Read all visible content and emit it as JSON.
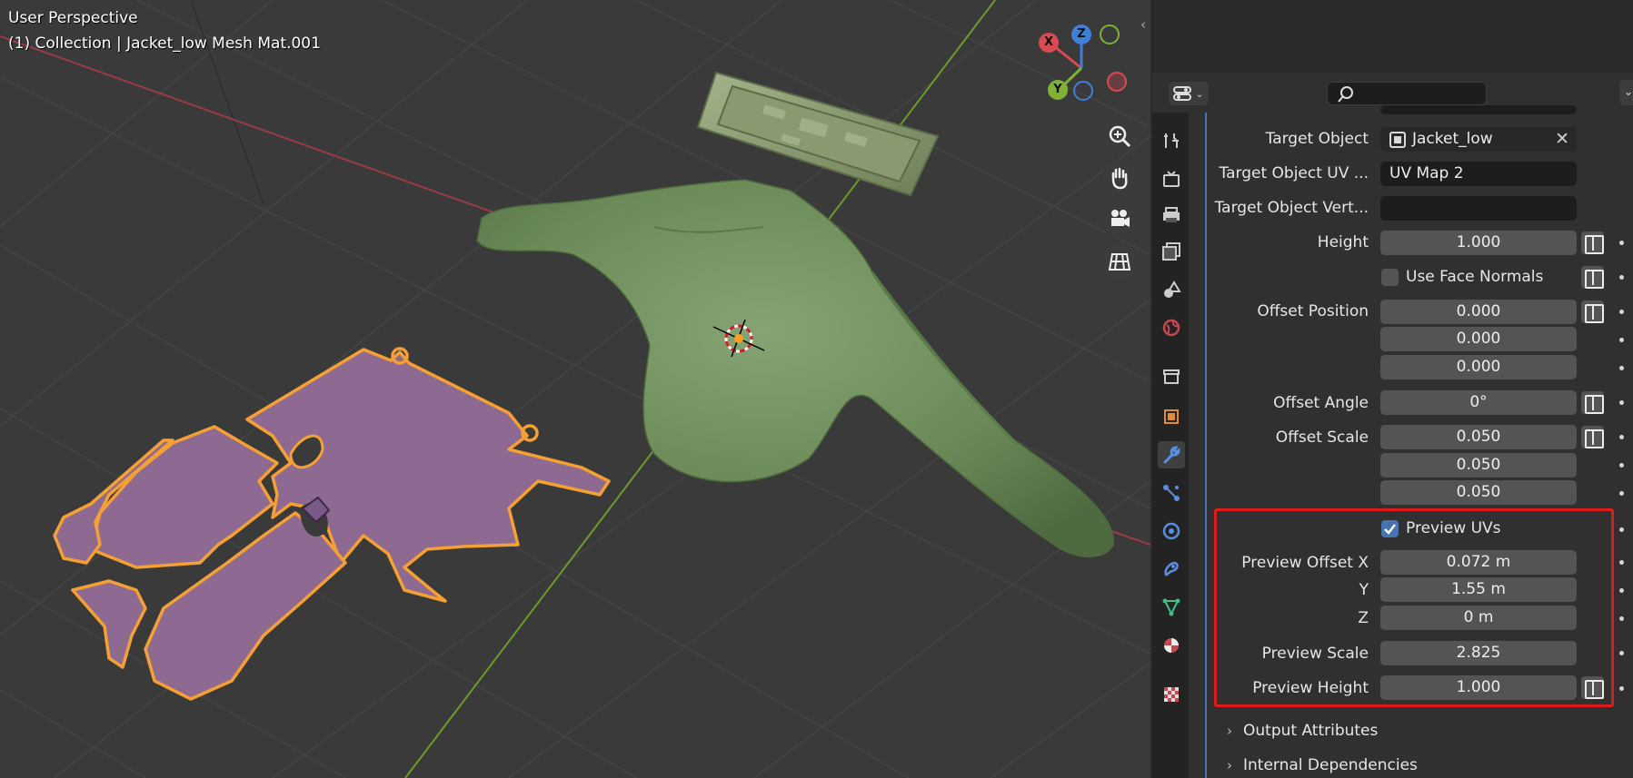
{
  "viewport": {
    "title": "User Perspective",
    "subtitle": "(1) Collection | Jacket_low Mesh Mat.001",
    "gizmo": {
      "x": "X",
      "y": "Y",
      "z": "Z"
    },
    "tools": [
      "zoom-icon",
      "pan-hand-icon",
      "camera-icon",
      "grid-ortho-icon"
    ]
  },
  "properties": {
    "fields": {
      "target_object_label": "Target Object",
      "target_object_value": "Jacket_low",
      "target_uv_label": "Target Object UV ...",
      "target_uv_value": "UV Map 2",
      "target_vert_label": "Target Object Vert...",
      "target_vert_value": "",
      "height_label": "Height",
      "height_value": "1.000",
      "use_face_normals_label": "Use Face Normals",
      "offset_position_label": "Offset Position",
      "offset_position_values": [
        "0.000",
        "0.000",
        "0.000"
      ],
      "offset_angle_label": "Offset Angle",
      "offset_angle_value": "0°",
      "offset_scale_label": "Offset Scale",
      "offset_scale_values": [
        "0.050",
        "0.050",
        "0.050"
      ],
      "preview_uvs_label": "Preview UVs",
      "preview_offset_x_label": "Preview Offset X",
      "preview_offset_x_value": "0.072 m",
      "preview_offset_y_label": "Y",
      "preview_offset_y_value": "1.55 m",
      "preview_offset_z_label": "Z",
      "preview_offset_z_value": "0 m",
      "preview_scale_label": "Preview Scale",
      "preview_scale_value": "2.825",
      "preview_height_label": "Preview Height",
      "preview_height_value": "1.000"
    },
    "subpanels": [
      "Output Attributes",
      "Internal Dependencies"
    ]
  },
  "colors": {
    "accent": "#4772b3",
    "highlight": "#e01b1b",
    "selection_outline": "#f5a033",
    "uv_fill": "#8e6a92",
    "mesh_green": "#6d8a5a"
  }
}
